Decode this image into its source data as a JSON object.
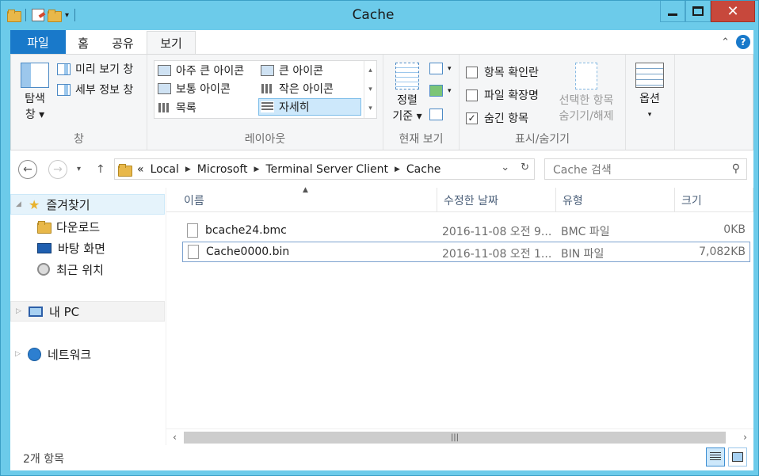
{
  "window": {
    "title": "Cache"
  },
  "ribbon": {
    "tabs": [
      "파일",
      "홈",
      "공유",
      "보기"
    ],
    "panes_group": {
      "navpane_label_1": "탐색",
      "navpane_label_2": "창 ▾",
      "preview": "미리 보기 창",
      "details": "세부 정보 창",
      "label": "창"
    },
    "layout_group": {
      "items": [
        "아주 큰 아이콘",
        "큰 아이콘",
        "보통 아이콘",
        "작은 아이콘",
        "목록",
        "자세히"
      ],
      "selected": "자세히",
      "label": "레이아웃"
    },
    "current_view_group": {
      "sort_1": "정렬",
      "sort_2": "기준 ▾",
      "label": "현재 보기"
    },
    "show_hide_group": {
      "item_checkboxes": "항목 확인란",
      "file_extensions": "파일 확장명",
      "hidden_items": "숨긴 항목",
      "item_checkboxes_checked": false,
      "file_extensions_checked": false,
      "hidden_items_checked": true,
      "hide_selected_1": "선택한 항목",
      "hide_selected_2": "숨기기/해제",
      "label": "표시/숨기기"
    },
    "options": {
      "label": "옵션",
      "arrow": "▾"
    }
  },
  "address": {
    "overflow": "«",
    "crumbs": [
      "Local",
      "Microsoft",
      "Terminal Server Client",
      "Cache"
    ],
    "search_placeholder": "Cache 검색"
  },
  "navpane": {
    "favorites": "즐겨찾기",
    "downloads": "다운로드",
    "desktop": "바탕 화면",
    "recent": "최근 위치",
    "pc": "내 PC",
    "network": "네트워크"
  },
  "columns": {
    "name": "이름",
    "date": "수정한 날짜",
    "type": "유형",
    "size": "크기"
  },
  "files": [
    {
      "name": "bcache24.bmc",
      "date": "2016-11-08 오전 9...",
      "type": "BMC 파일",
      "size": "0KB"
    },
    {
      "name": "Cache0000.bin",
      "date": "2016-11-08 오전 1...",
      "type": "BIN 파일",
      "size": "7,082KB"
    }
  ],
  "status": {
    "count": "2개 항목"
  }
}
